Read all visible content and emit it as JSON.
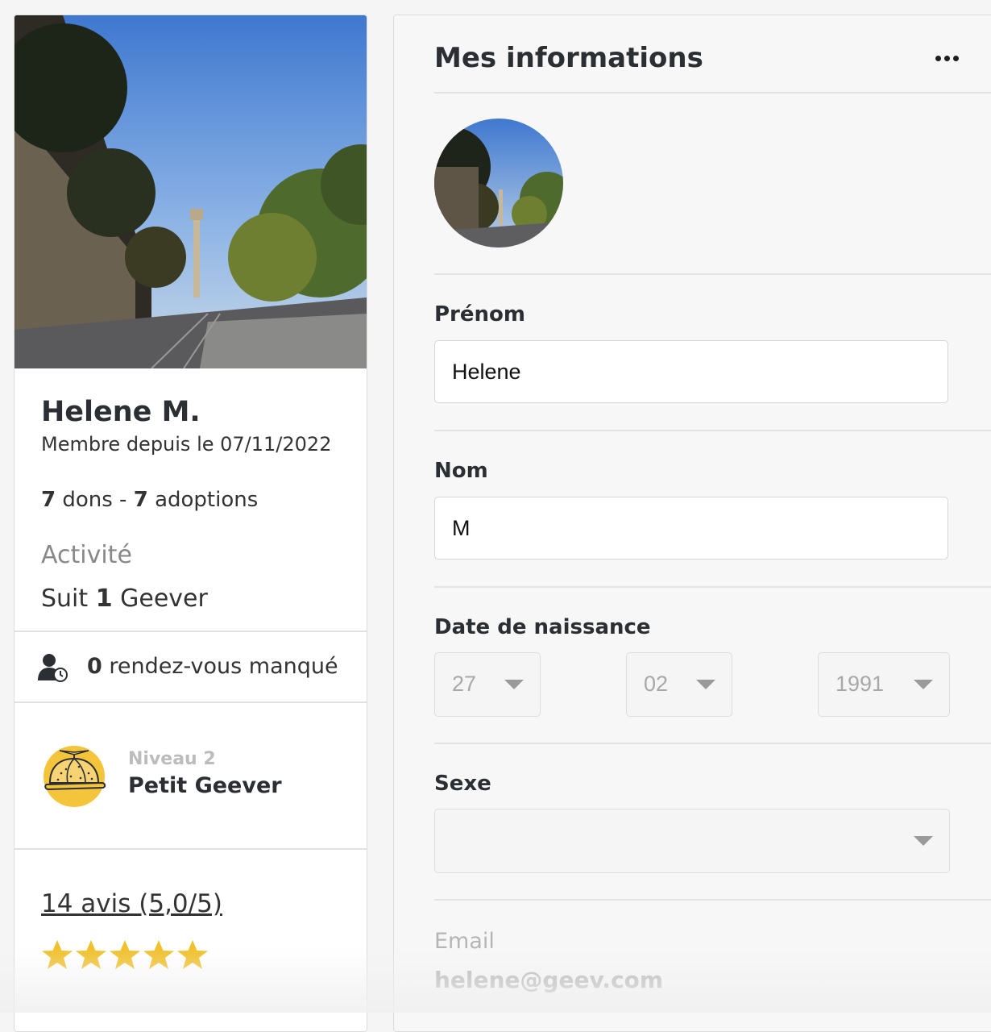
{
  "profile": {
    "name": "Helene M.",
    "member_since": "Membre depuis le 07/11/2022",
    "donations_count": "7",
    "donations_label": " dons - ",
    "adoptions_count": "7",
    "adoptions_label": " adoptions",
    "activity_title": "Activité",
    "follows_prefix": "Suit ",
    "follows_count": "1",
    "follows_suffix": " Geever",
    "missed_count": "0",
    "missed_label": " rendez-vous manqué",
    "missed_icon": "user-clock-icon",
    "level_icon": "propeller-cap-icon",
    "level_number": "Niveau 2",
    "level_name": "Petit Geever",
    "reviews_link": "14 avis (5,0/5)",
    "rating": 5,
    "star_color": "#f0c12c"
  },
  "form": {
    "title": "Mes informations",
    "more_icon": "more-dots-icon",
    "first_name_label": "Prénom",
    "first_name_value": "Helene",
    "last_name_label": "Nom",
    "last_name_value": "M",
    "birthdate_label": "Date de naissance",
    "birth_day": "27",
    "birth_month": "02",
    "birth_year": "1991",
    "sex_label": "Sexe",
    "sex_value": "",
    "email_label": "Email",
    "email_value": "helene@geev.com"
  }
}
